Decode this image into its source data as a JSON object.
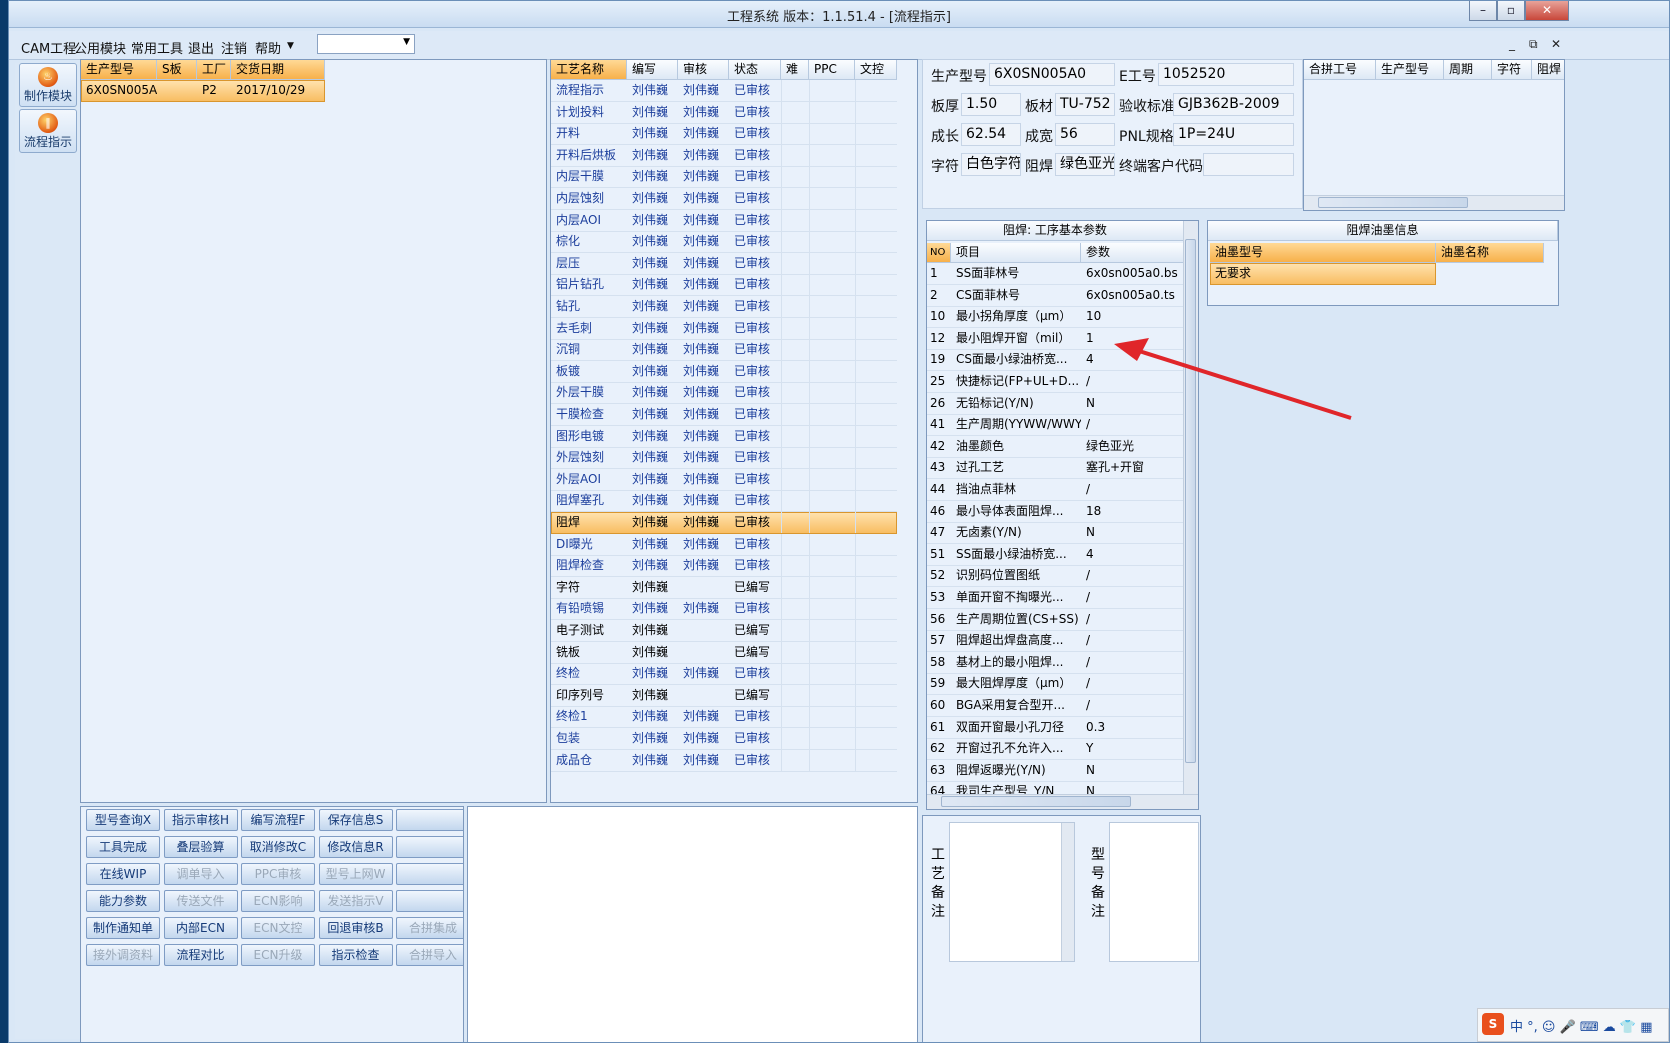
{
  "window": {
    "title": "工程系统  版本：1.1.51.4 - [流程指示]"
  },
  "menu": {
    "items": [
      "CAM工程",
      "公用模块",
      "常用工具",
      "退出",
      "注销",
      "帮助"
    ],
    "combo_value": ""
  },
  "modules": [
    {
      "label": "制作模块",
      "glyph": "♨"
    },
    {
      "label": "流程指示",
      "glyph": "‖"
    }
  ],
  "product_table": {
    "headers": [
      "生产型号",
      "S板",
      "工厂",
      "交货日期"
    ],
    "rows": [
      [
        "6X0SN005A0",
        "",
        "P2",
        "2017/10/29"
      ]
    ]
  },
  "process_table": {
    "headers": [
      "工艺名称",
      "编写",
      "审核",
      "状态",
      "难",
      "PPC",
      "文控"
    ],
    "selected_index": 20,
    "rows": [
      {
        "name": "流程指示",
        "writer": "刘伟巍",
        "reviewer": "刘伟巍",
        "status": "已审核"
      },
      {
        "name": "计划投料",
        "writer": "刘伟巍",
        "reviewer": "刘伟巍",
        "status": "已审核"
      },
      {
        "name": "开料",
        "writer": "刘伟巍",
        "reviewer": "刘伟巍",
        "status": "已审核"
      },
      {
        "name": "开料后烘板",
        "writer": "刘伟巍",
        "reviewer": "刘伟巍",
        "status": "已审核"
      },
      {
        "name": "内层干膜",
        "writer": "刘伟巍",
        "reviewer": "刘伟巍",
        "status": "已审核"
      },
      {
        "name": "内层蚀刻",
        "writer": "刘伟巍",
        "reviewer": "刘伟巍",
        "status": "已审核"
      },
      {
        "name": "内层AOI",
        "writer": "刘伟巍",
        "reviewer": "刘伟巍",
        "status": "已审核"
      },
      {
        "name": "棕化",
        "writer": "刘伟巍",
        "reviewer": "刘伟巍",
        "status": "已审核"
      },
      {
        "name": "层压",
        "writer": "刘伟巍",
        "reviewer": "刘伟巍",
        "status": "已审核"
      },
      {
        "name": "铝片钻孔",
        "writer": "刘伟巍",
        "reviewer": "刘伟巍",
        "status": "已审核"
      },
      {
        "name": "钻孔",
        "writer": "刘伟巍",
        "reviewer": "刘伟巍",
        "status": "已审核"
      },
      {
        "name": "去毛刺",
        "writer": "刘伟巍",
        "reviewer": "刘伟巍",
        "status": "已审核"
      },
      {
        "name": "沉铜",
        "writer": "刘伟巍",
        "reviewer": "刘伟巍",
        "status": "已审核"
      },
      {
        "name": "板镀",
        "writer": "刘伟巍",
        "reviewer": "刘伟巍",
        "status": "已审核"
      },
      {
        "name": "外层干膜",
        "writer": "刘伟巍",
        "reviewer": "刘伟巍",
        "status": "已审核"
      },
      {
        "name": "干膜检查",
        "writer": "刘伟巍",
        "reviewer": "刘伟巍",
        "status": "已审核"
      },
      {
        "name": "图形电镀",
        "writer": "刘伟巍",
        "reviewer": "刘伟巍",
        "status": "已审核"
      },
      {
        "name": "外层蚀刻",
        "writer": "刘伟巍",
        "reviewer": "刘伟巍",
        "status": "已审核"
      },
      {
        "name": "外层AOI",
        "writer": "刘伟巍",
        "reviewer": "刘伟巍",
        "status": "已审核"
      },
      {
        "name": "阻焊塞孔",
        "writer": "刘伟巍",
        "reviewer": "刘伟巍",
        "status": "已审核"
      },
      {
        "name": "阻焊",
        "writer": "刘伟巍",
        "reviewer": "刘伟巍",
        "status": "已审核"
      },
      {
        "name": "DI曝光",
        "writer": "刘伟巍",
        "reviewer": "刘伟巍",
        "status": "已审核"
      },
      {
        "name": "阻焊检查",
        "writer": "刘伟巍",
        "reviewer": "刘伟巍",
        "status": "已审核"
      },
      {
        "name": "字符",
        "writer": "刘伟巍",
        "reviewer": "",
        "status": "已编写"
      },
      {
        "name": "有铅喷锡",
        "writer": "刘伟巍",
        "reviewer": "刘伟巍",
        "status": "已审核"
      },
      {
        "name": "电子测试",
        "writer": "刘伟巍",
        "reviewer": "",
        "status": "已编写"
      },
      {
        "name": "铣板",
        "writer": "刘伟巍",
        "reviewer": "",
        "status": "已编写"
      },
      {
        "name": "终检",
        "writer": "刘伟巍",
        "reviewer": "刘伟巍",
        "status": "已审核"
      },
      {
        "name": "印序列号",
        "writer": "刘伟巍",
        "reviewer": "",
        "status": "已编写"
      },
      {
        "name": "终检1",
        "writer": "刘伟巍",
        "reviewer": "刘伟巍",
        "status": "已审核"
      },
      {
        "name": "包装",
        "writer": "刘伟巍",
        "reviewer": "刘伟巍",
        "status": "已审核"
      },
      {
        "name": "成品仓",
        "writer": "刘伟巍",
        "reviewer": "刘伟巍",
        "status": "已审核"
      }
    ]
  },
  "info": {
    "model_label": "生产型号",
    "model": "6X0SN005A0",
    "eno_label": "E工号",
    "eno": "1052520",
    "thick_label": "板厚",
    "thick": "1.50",
    "material_label": "板材",
    "material": "TU-752",
    "std_label": "验收标准",
    "std": "GJB362B-2009",
    "length_label": "成长",
    "length": "62.54",
    "width_label": "成宽",
    "width": "56",
    "pnl_label": "PNL规格",
    "pnl": "1P=24U",
    "char_label": "字符",
    "char": "白色字符",
    "mask_label": "阻焊",
    "mask": "绿色亚光",
    "cust_label": "终端客户代码",
    "cust": ""
  },
  "combine_table": {
    "headers": [
      "合拼工号",
      "生产型号",
      "周期",
      "字符",
      "阻焊"
    ]
  },
  "params": {
    "title": "阻焊: 工序基本参数",
    "headers": [
      "NO",
      "项目",
      "参数"
    ],
    "rows": [
      {
        "no": "1",
        "item": "SS面菲林号",
        "value": "6x0sn005a0.bs"
      },
      {
        "no": "2",
        "item": "CS面菲林号",
        "value": "6x0sn005a0.ts"
      },
      {
        "no": "10",
        "item": "最小拐角厚度（μm）",
        "value": "10"
      },
      {
        "no": "12",
        "item": "最小阻焊开窗（mil）",
        "value": "1"
      },
      {
        "no": "19",
        "item": "CS面最小绿油桥宽...",
        "value": "4"
      },
      {
        "no": "25",
        "item": "快捷标记(FP+UL+D...",
        "value": "/"
      },
      {
        "no": "26",
        "item": "无铅标记(Y/N)",
        "value": "N"
      },
      {
        "no": "41",
        "item": "生产周期(YYWW/WWYY)",
        "value": "/"
      },
      {
        "no": "42",
        "item": "油墨颜色",
        "value": "绿色亚光"
      },
      {
        "no": "43",
        "item": "过孔工艺",
        "value": "塞孔+开窗"
      },
      {
        "no": "44",
        "item": "挡油点菲林",
        "value": "/"
      },
      {
        "no": "46",
        "item": "最小导体表面阻焊...",
        "value": "18"
      },
      {
        "no": "47",
        "item": "无卤素(Y/N)",
        "value": "N"
      },
      {
        "no": "51",
        "item": "SS面最小绿油桥宽...",
        "value": "4"
      },
      {
        "no": "52",
        "item": "识别码位置图纸",
        "value": "/"
      },
      {
        "no": "53",
        "item": "单面开窗不掏曝光...",
        "value": "/"
      },
      {
        "no": "56",
        "item": "生产周期位置(CS+SS)",
        "value": "/"
      },
      {
        "no": "57",
        "item": "阻焊超出焊盘高度...",
        "value": "/"
      },
      {
        "no": "58",
        "item": "基材上的最小阻焊...",
        "value": "/"
      },
      {
        "no": "59",
        "item": "最大阻焊厚度（μm）",
        "value": "/"
      },
      {
        "no": "60",
        "item": "BGA采用复合型开...",
        "value": "/"
      },
      {
        "no": "61",
        "item": "双面开窗最小孔刀径",
        "value": "0.3"
      },
      {
        "no": "62",
        "item": "开窗过孔不允许入...",
        "value": "Y"
      },
      {
        "no": "63",
        "item": "阻焊返曝光(Y/N)",
        "value": "N"
      },
      {
        "no": "64",
        "item": "我司生产型号_Y/N",
        "value": "N"
      }
    ]
  },
  "ink": {
    "title": "阻焊油墨信息",
    "headers": [
      "油墨型号",
      "油墨名称"
    ],
    "rows": [
      [
        "无要求",
        ""
      ]
    ]
  },
  "notes": {
    "process_label": "工艺备注",
    "model_label": "型号备注"
  },
  "buttons": [
    {
      "label": "型号查询X",
      "enabled": true
    },
    {
      "label": "指示审核H",
      "enabled": true
    },
    {
      "label": "编写流程F",
      "enabled": true
    },
    {
      "label": "保存信息S",
      "enabled": true
    },
    {
      "label": "",
      "enabled": true
    },
    {
      "label": "工具完成",
      "enabled": true
    },
    {
      "label": "叠层验算",
      "enabled": true
    },
    {
      "label": "取消修改C",
      "enabled": true
    },
    {
      "label": "修改信息R",
      "enabled": true
    },
    {
      "label": "",
      "enabled": true
    },
    {
      "label": "在线WIP",
      "enabled": true
    },
    {
      "label": "调单导入",
      "enabled": false
    },
    {
      "label": "PPC审核",
      "enabled": false
    },
    {
      "label": "型号上网W",
      "enabled": false
    },
    {
      "label": "",
      "enabled": true
    },
    {
      "label": "能力参数",
      "enabled": true
    },
    {
      "label": "传送文件",
      "enabled": false
    },
    {
      "label": "ECN影响",
      "enabled": false
    },
    {
      "label": "发送指示V",
      "enabled": false
    },
    {
      "label": "",
      "enabled": true
    },
    {
      "label": "制作通知单",
      "enabled": true
    },
    {
      "label": "内部ECN",
      "enabled": true
    },
    {
      "label": "ECN文控",
      "enabled": false
    },
    {
      "label": "回退审核B",
      "enabled": true
    },
    {
      "label": "合拼集成",
      "enabled": false
    },
    {
      "label": "接外调资料",
      "enabled": false
    },
    {
      "label": "流程对比",
      "enabled": true
    },
    {
      "label": "ECN升级",
      "enabled": false
    },
    {
      "label": "指示检查",
      "enabled": true
    },
    {
      "label": "合拼导入",
      "enabled": false
    }
  ],
  "tray": {
    "text": "中 °, ☺ 🎤 ⌨ ☁ 👕 ▦"
  },
  "colors": {
    "accent": "#f7b04a",
    "link": "#1c3e9c",
    "annotation_arrow": "#e0262a"
  }
}
